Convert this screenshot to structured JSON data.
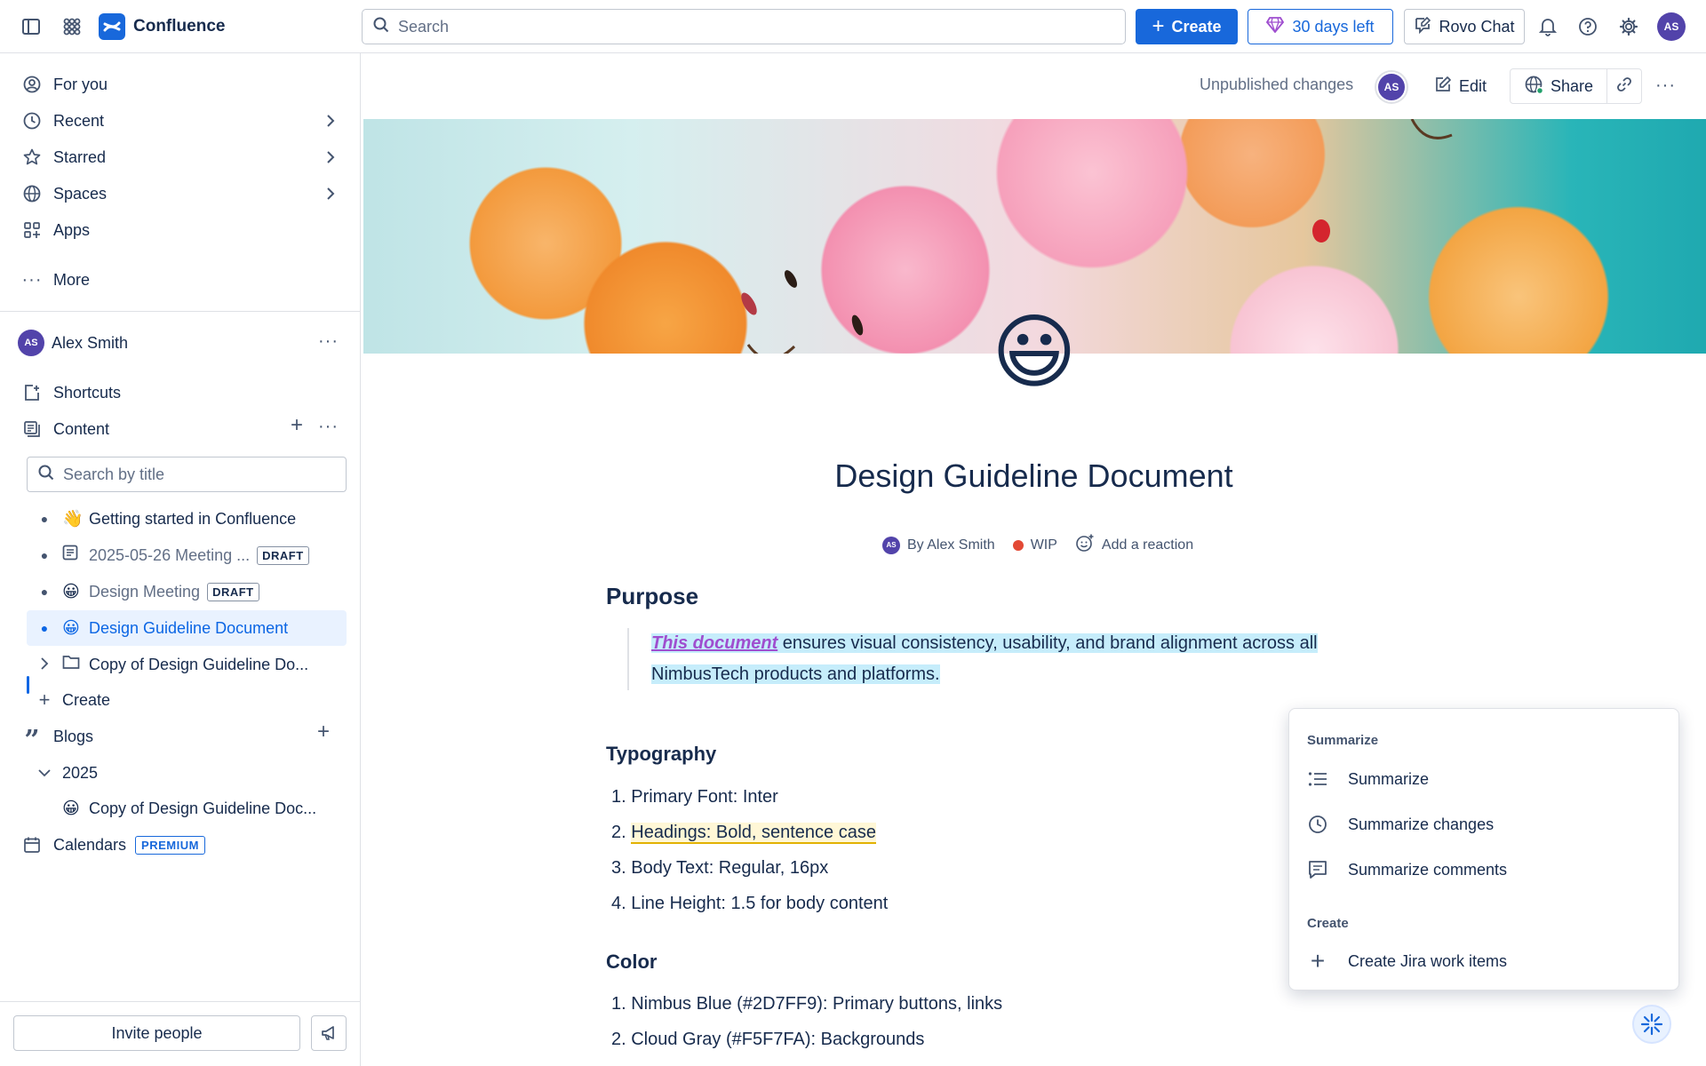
{
  "topbar": {
    "app_name": "Confluence",
    "search_placeholder": "Search",
    "create_label": "Create",
    "trial_label": "30 days left",
    "rovo_label": "Rovo Chat",
    "user_initials": "AS"
  },
  "sidebar": {
    "nav": [
      {
        "label": "For you"
      },
      {
        "label": "Recent"
      },
      {
        "label": "Starred"
      },
      {
        "label": "Spaces"
      },
      {
        "label": "Apps"
      },
      {
        "label": "More"
      }
    ],
    "user": {
      "name": "Alex Smith",
      "initials": "AS"
    },
    "shortcuts_label": "Shortcuts",
    "content_label": "Content",
    "search_placeholder": "Search by title",
    "tree": [
      {
        "emoji": "👋",
        "label": "Getting started in Confluence",
        "badge": ""
      },
      {
        "emoji": "",
        "label": "2025-05-26 Meeting ...",
        "badge": "DRAFT"
      },
      {
        "emoji": "😀",
        "label": "Design Meeting",
        "badge": "DRAFT"
      },
      {
        "emoji": "😀",
        "label": "Design Guideline Document",
        "badge": ""
      },
      {
        "emoji": "",
        "label": "Copy of Design Guideline Do...",
        "badge": ""
      }
    ],
    "create_label": "Create",
    "blogs_label": "Blogs",
    "blog_year": "2025",
    "blog_item": {
      "emoji": "😀",
      "label": "Copy of Design Guideline Doc..."
    },
    "calendars_label": "Calendars",
    "premium_badge": "PREMIUM",
    "invite_label": "Invite people"
  },
  "pagebar": {
    "unpublished": "Unpublished changes",
    "avatar_initials": "AS",
    "edit_label": "Edit",
    "share_label": "Share"
  },
  "document": {
    "emoji": "😃",
    "title": "Design Guideline Document",
    "byline": {
      "author": "By Alex Smith",
      "status": "WIP",
      "reaction": "Add a reaction",
      "initials": "AS"
    },
    "purpose_heading": "Purpose",
    "purpose_link": "This document",
    "purpose_line1": " ensures visual consistency, usability, and brand alignment across all",
    "purpose_line2": "NimbusTech products and platforms.",
    "typography_heading": "Typography",
    "typography_items": [
      "1. Primary Font: Inter",
      "Headings: Bold, sentence case",
      "3. Body Text: Regular, 16px",
      "4. Line Height: 1.5 for body content"
    ],
    "typography_item2_num": "2. ",
    "color_heading": "Color",
    "color_items": [
      "1. Nimbus Blue (#2D7FF9): Primary buttons, links",
      "2. Cloud Gray (#F5F7FA): Backgrounds"
    ]
  },
  "popup": {
    "section_summarize": "Summarize",
    "items": [
      "Summarize",
      "Summarize changes",
      "Summarize comments"
    ],
    "section_create": "Create",
    "create_item": "Create Jira work items"
  },
  "colors": {
    "brand": "#1868db",
    "selected": "#e9f2ff",
    "wip": "#e56910"
  }
}
